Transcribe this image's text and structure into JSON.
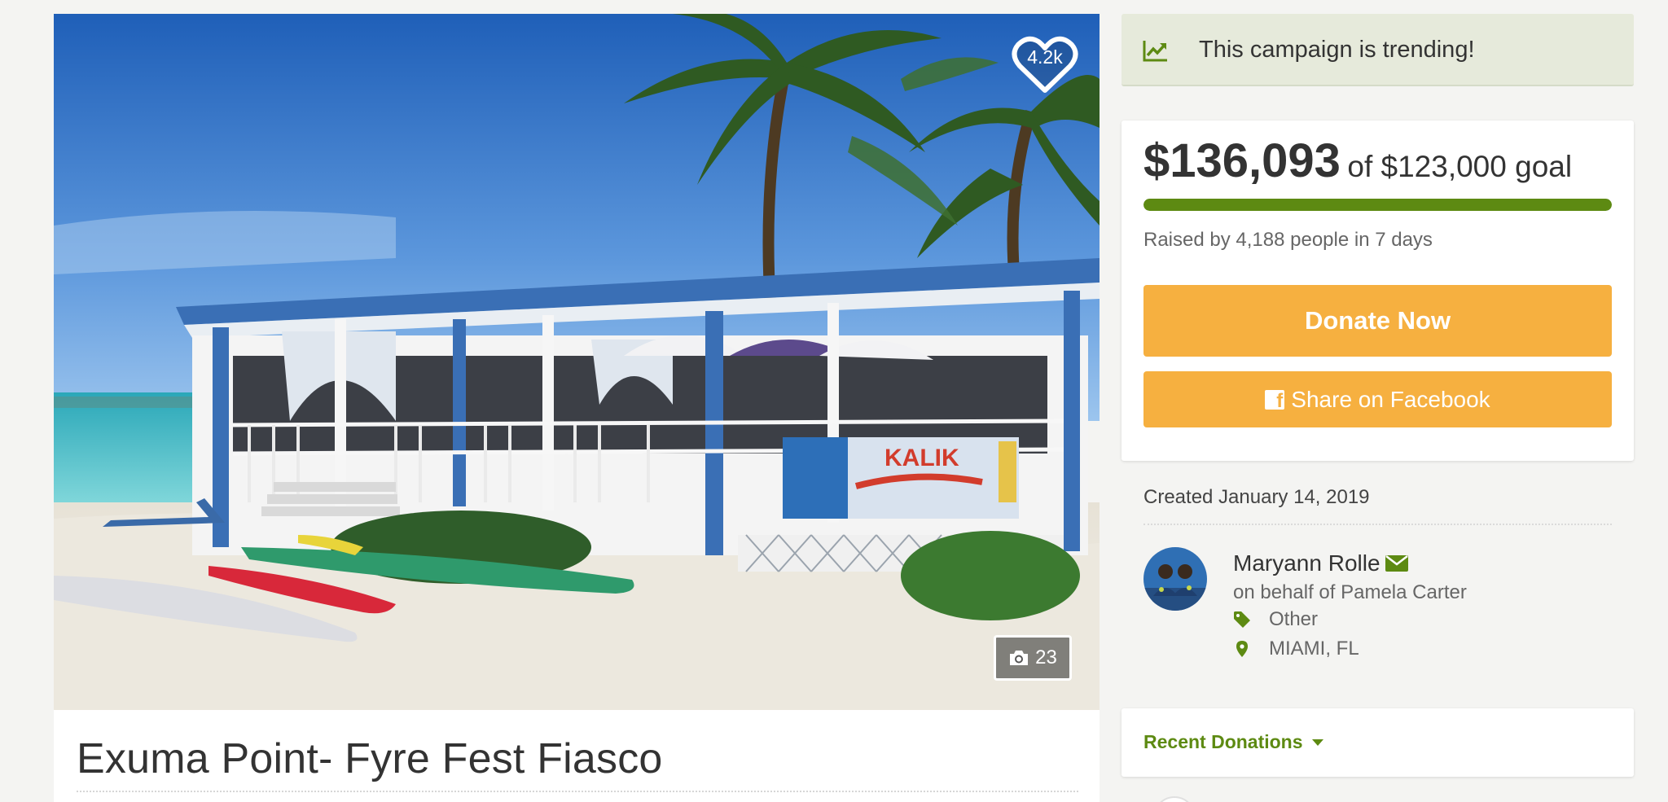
{
  "campaign": {
    "title": "Exuma Point- Fyre Fest Fiasco",
    "like_count": "4.2k",
    "photo_count": "23",
    "photo_sign_text": "KALIK"
  },
  "trending": {
    "text": "This campaign is trending!",
    "icon": "chart-trend-icon"
  },
  "stats": {
    "raised": "$136,093",
    "goal_text": "of $123,000 goal",
    "progress_fraction": 1.0,
    "raised_by": "Raised by 4,188 people in 7 days"
  },
  "actions": {
    "donate_label": "Donate Now",
    "share_label": "Share on Facebook"
  },
  "created": "Created January 14, 2019",
  "organizer": {
    "name": "Maryann Rolle",
    "behalf": "on behalf of Pamela Carter",
    "category": "Other",
    "location": "MIAMI, FL"
  },
  "recent": {
    "label": "Recent Donations"
  },
  "colors": {
    "accent_green": "#5d8a12",
    "button_orange": "#f6b040",
    "trending_bg": "#e6eadb"
  }
}
